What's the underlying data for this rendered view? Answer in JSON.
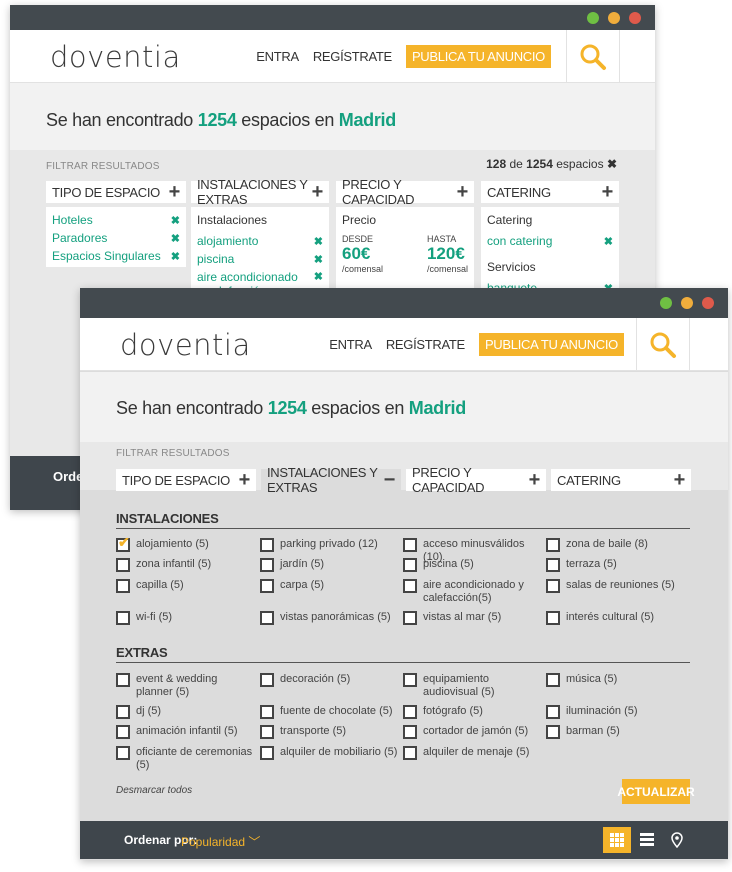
{
  "brand": {
    "logo": "doventia",
    "accent": "#f5b42a",
    "green": "#14a07f",
    "dark": "#3f464c"
  },
  "nav": {
    "login": "ENTRA",
    "register": "REGÍSTRATE",
    "publish": "PUBLICA TU ANUNCIO"
  },
  "results": {
    "prefix": "Se han encontrado",
    "count": "1254",
    "middle": "espacios en",
    "city": "Madrid"
  },
  "filter_label": "FILTRAR RESULTADOS",
  "back": {
    "pager": {
      "shown": "128",
      "de": "de",
      "total": "1254",
      "suffix": "espacios"
    },
    "columns": [
      {
        "title": "TIPO DE ESPACIO",
        "items": [
          "Hoteles",
          "Paradores",
          "Espacios Singulares"
        ]
      },
      {
        "title": "INSTALACIONES Y EXTRAS",
        "sub": "Instalaciones",
        "items": [
          "alojamiento",
          "piscina",
          "aire acondicionado y calefacción"
        ]
      },
      {
        "title": "PRECIO Y CAPACIDAD",
        "sub": "Precio",
        "desde_lbl": "DESDE",
        "desde": "60€",
        "hasta_lbl": "HASTA",
        "hasta": "120€",
        "per": "/comensal"
      },
      {
        "title": "CATERING",
        "sub": "Catering",
        "item": "con catering",
        "sub2": "Servicios",
        "item2": "banquete"
      }
    ],
    "order_label": "Ordenar"
  },
  "front": {
    "tabs": [
      "TIPO DE ESPACIO",
      "INSTALACIONES Y EXTRAS",
      "PRECIO Y CAPACIDAD",
      "CATERING"
    ],
    "instalaciones_title": "INSTALACIONES",
    "instalaciones": [
      [
        "alojamiento (5)",
        "zona infantil (5)",
        "capilla (5)",
        "wi-fi (5)"
      ],
      [
        "parking privado (12)",
        "jardín (5)",
        "carpa (5)",
        "vistas panorámicas (5)"
      ],
      [
        "acceso minusválidos (10)",
        "piscina (5)",
        "aire acondicionado y calefacción(5)",
        "vistas al mar (5)"
      ],
      [
        "zona de baile (8)",
        "terraza (5)",
        "salas de reuniones (5)",
        "interés cultural (5)"
      ]
    ],
    "extras_title": "EXTRAS",
    "extras": [
      [
        "event & wedding planner (5)",
        "dj (5)",
        "animación infantil (5)",
        "oficiante de ceremonias (5)"
      ],
      [
        "decoración (5)",
        "fuente de chocolate (5)",
        "transporte (5)",
        "alquiler de mobiliario (5)"
      ],
      [
        "equipamiento audiovisual (5)",
        "fotógrafo (5)",
        "cortador de jamón (5)",
        "alquiler de menaje (5)"
      ],
      [
        "música (5)",
        "iluminación (5)",
        "barman (5)",
        ""
      ]
    ],
    "unmark": "Desmarcar todos",
    "update": "ACTUALIZAR",
    "order_label": "Ordenar por:",
    "order_value": "Popularidad"
  }
}
